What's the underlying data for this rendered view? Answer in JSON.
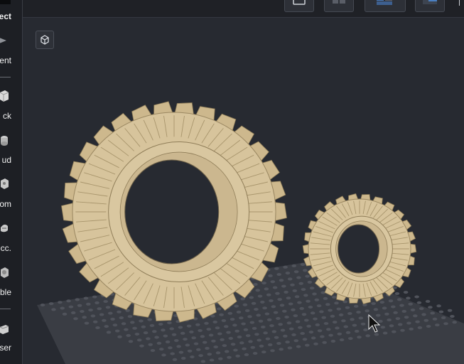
{
  "sidebar": {
    "tools": [
      {
        "id": "select",
        "label": "ect",
        "icon": "select-icon"
      },
      {
        "id": "movement",
        "label": "ment",
        "icon": "arrow-icon"
      },
      {
        "id": "block",
        "label": "ck",
        "icon": "cube-icon"
      },
      {
        "id": "stud",
        "label": "ud",
        "icon": "stud-icon"
      },
      {
        "id": "custom",
        "label": "om",
        "icon": "custom-part-icon"
      },
      {
        "id": "accessory",
        "label": "cc.",
        "icon": "accessory-icon"
      },
      {
        "id": "vehicle",
        "label": "ble",
        "icon": "vehicle-icon"
      },
      {
        "id": "user",
        "label": "ser",
        "icon": "user-parts-icon"
      }
    ]
  },
  "topbar": {
    "view_buttons": [
      "single-view-icon",
      "split-view-icon",
      "quad-view-icon",
      "side-view-icon"
    ]
  },
  "viewport": {
    "view_cube_icon": "view-cube-icon",
    "objects": [
      {
        "name": "large-tire",
        "type": "tractor tire",
        "color": "#d7c49c"
      },
      {
        "name": "small-tire",
        "type": "tractor tire",
        "color": "#d7c49c"
      }
    ],
    "baseplate_color": "#3a3d44",
    "stud_color": "#50535b"
  },
  "colors": {
    "background": "#272a31",
    "sidebar": "#1d1f24",
    "accent": "#4a7fc1"
  }
}
